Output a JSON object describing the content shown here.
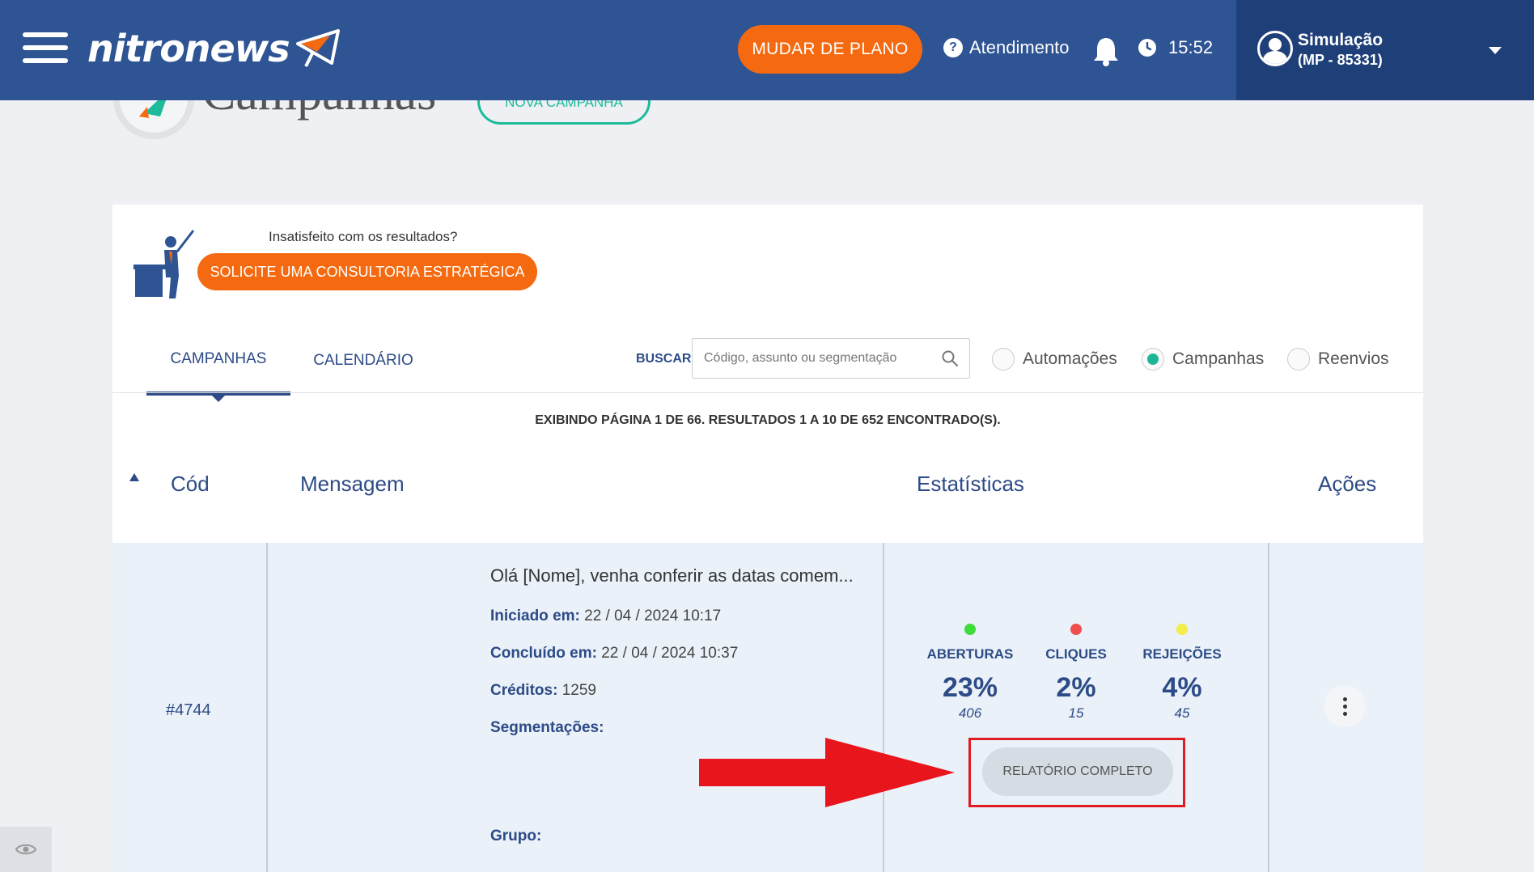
{
  "header": {
    "logo_text": "nitronews",
    "plan_button": "MUDAR DE PLANO",
    "support_label": "Atendimento",
    "time": "15:52",
    "user_name": "Simulação",
    "user_account": "(MP - 85331)"
  },
  "page": {
    "title": "Campanhas",
    "new_campaign_button": "NOVA CAMPANHA"
  },
  "promo": {
    "question": "Insatisfeito com os resultados?",
    "button": "SOLICITE UMA CONSULTORIA ESTRATÉGICA"
  },
  "tabs": {
    "campanhas": "CAMPANHAS",
    "calendario": "CALENDÁRIO"
  },
  "search": {
    "label": "BUSCAR",
    "placeholder": "Código, assunto ou segmentação"
  },
  "filters": [
    {
      "label": "Automações",
      "selected": false
    },
    {
      "label": "Campanhas",
      "selected": true
    },
    {
      "label": "Reenvios",
      "selected": false
    }
  ],
  "results_text": "EXIBINDO PÁGINA 1 DE 66. RESULTADOS 1 A 10 DE 652 ENCONTRADO(S).",
  "table": {
    "headers": {
      "cod": "Cód",
      "mensagem": "Mensagem",
      "estatisticas": "Estatísticas",
      "acoes": "Ações"
    },
    "rows": [
      {
        "code": "#4744",
        "message": "Olá [Nome], venha conferir as datas comem...",
        "iniciado_label": "Iniciado em:",
        "iniciado_value": "22 / 04 / 2024 10:17",
        "concluido_label": "Concluído em:",
        "concluido_value": "22 / 04 / 2024 10:37",
        "creditos_label": "Créditos:",
        "creditos_value": "1259",
        "segmentacoes_label": "Segmentações:",
        "grupo_label": "Grupo:",
        "stats": [
          {
            "label": "ABERTURAS",
            "pct": "23%",
            "count": "406",
            "color": "#3ddc3a"
          },
          {
            "label": "CLIQUES",
            "pct": "2%",
            "count": "15",
            "color": "#f04d4d"
          },
          {
            "label": "REJEIÇÕES",
            "pct": "4%",
            "count": "45",
            "color": "#f2ee4a"
          }
        ],
        "report_button": "RELATÓRIO COMPLETO"
      }
    ]
  },
  "colors": {
    "topbar": "#2e5494",
    "user_panel": "#1f3f78",
    "accent_orange": "#f56a10",
    "teal": "#1dbb9b",
    "highlight_red": "#e01b23"
  }
}
